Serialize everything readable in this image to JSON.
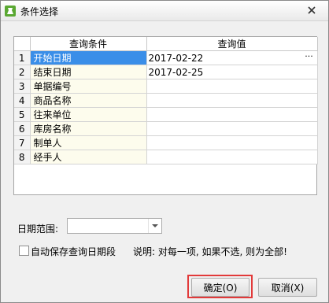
{
  "window": {
    "title": "条件选择"
  },
  "grid": {
    "headers": [
      "查询条件",
      "查询值"
    ],
    "rows": [
      {
        "num": "1",
        "condition": "开始日期",
        "value": "2017-02-22"
      },
      {
        "num": "2",
        "condition": "结束日期",
        "value": "2017-02-25"
      },
      {
        "num": "3",
        "condition": "单据编号",
        "value": ""
      },
      {
        "num": "4",
        "condition": "商品名称",
        "value": ""
      },
      {
        "num": "5",
        "condition": "往来单位",
        "value": ""
      },
      {
        "num": "6",
        "condition": "库房名称",
        "value": ""
      },
      {
        "num": "7",
        "condition": "制单人",
        "value": ""
      },
      {
        "num": "8",
        "condition": "经手人",
        "value": ""
      }
    ],
    "ellipsis": "···"
  },
  "date_range": {
    "label": "日期范围:",
    "value": ""
  },
  "auto_save": {
    "label": "自动保存查询日期段",
    "checked": false
  },
  "note": "说明: 对每一项, 如果不选, 则为全部!",
  "buttons": {
    "ok": "确定(O)",
    "cancel": "取消(X)"
  },
  "colors": {
    "selection": "#3a8ee8",
    "highlight_border": "#e23a3a"
  }
}
